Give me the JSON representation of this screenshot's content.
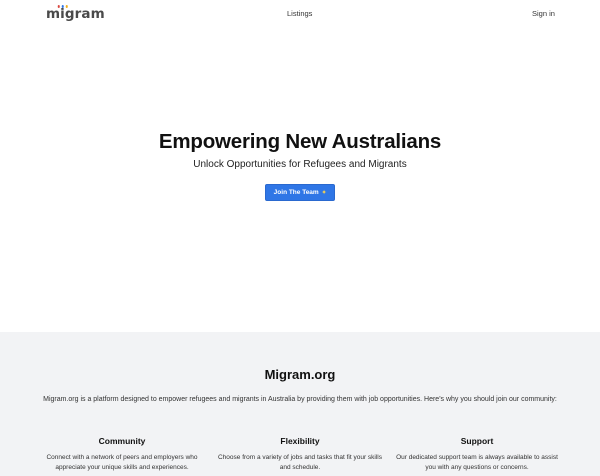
{
  "nav": {
    "logo": {
      "prefix": "m",
      "i": "i",
      "suffix": "gram",
      "dot_colors": [
        "#d9473f",
        "#2f76e6",
        "#f2b01e"
      ]
    },
    "listings_label": "Listings",
    "signin_label": "Sign in"
  },
  "hero": {
    "title": "Empowering New Australians",
    "subtitle": "Unlock Opportunities for Refugees and Migrants",
    "button_label": "Join The Team",
    "button_icon": "sparkle-icon",
    "button_color": "#2f76e6"
  },
  "about": {
    "title": "Migram.org",
    "intro": "Migram.org is a platform designed to empower refugees and migrants in Australia by providing them with job opportunities. Here's why you should join our community:",
    "features": [
      {
        "title": "Community",
        "text": "Connect with a network of peers and employers who appreciate your unique skills and experiences."
      },
      {
        "title": "Flexibility",
        "text": "Choose from a variety of jobs and tasks that fit your skills and schedule."
      },
      {
        "title": "Support",
        "text": "Our dedicated support team is always available to assist you with any questions or concerns."
      }
    ],
    "background": "#f2f3f5"
  }
}
